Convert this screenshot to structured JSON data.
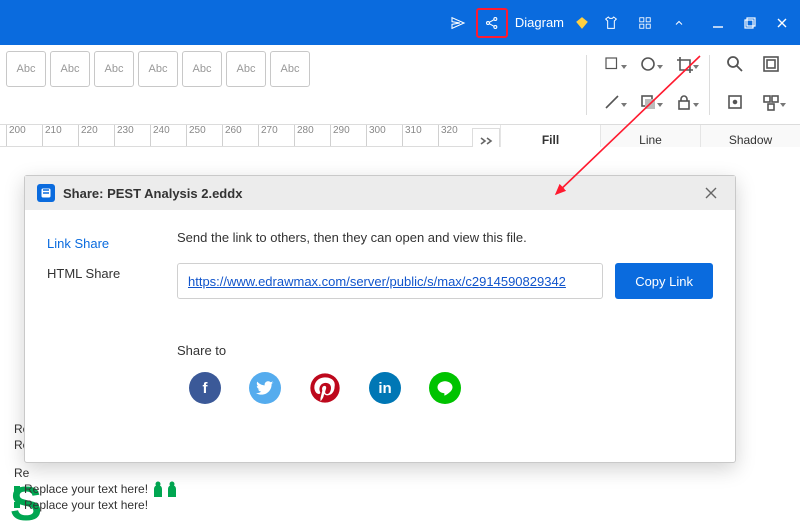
{
  "titlebar": {
    "diagram_label": "Diagram"
  },
  "toolbar": {
    "abc_label": "Abc"
  },
  "ruler": {
    "ticks": [
      "200",
      "210",
      "220",
      "230",
      "240",
      "250",
      "260",
      "270",
      "280",
      "290",
      "300",
      "310",
      "320"
    ]
  },
  "side_tabs": {
    "fill": "Fill",
    "line": "Line",
    "shadow": "Shadow"
  },
  "dialog": {
    "title": "Share: PEST Analysis 2.eddx",
    "tab_link": "Link Share",
    "tab_html": "HTML Share",
    "desc": "Send the link to others, then they can open and view this file.",
    "url": "https://www.edrawmax.com/server/public/s/max/c2914590829342",
    "copy_btn": "Copy Link",
    "share_to": "Share to"
  },
  "canvas": {
    "big_letter": "S",
    "line1_prefix": "Re",
    "line2_prefix": "Re",
    "line3_prefix": "Re",
    "replace1": "Replace your text here!",
    "replace2": "Replace your text here!"
  },
  "share_targets": {
    "facebook": "f",
    "twitter": "t",
    "pinterest": "P",
    "linkedin": "in",
    "line": "L"
  }
}
